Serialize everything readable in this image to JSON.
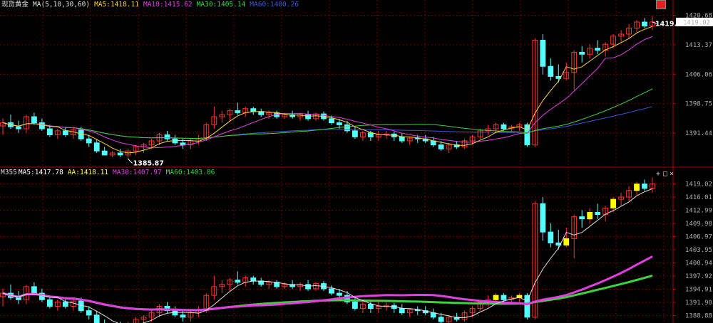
{
  "top": {
    "symbol": "现货黄金",
    "indicator": "MA(5,10,30,60)",
    "ma": [
      {
        "label": "MA5:1418.11",
        "color": "#ffd23f"
      },
      {
        "label": "MA10:1415.62",
        "color": "#e040e0"
      },
      {
        "label": "MA30:1405.14",
        "color": "#3fd23f"
      },
      {
        "label": "MA60:1400.26",
        "color": "#3a5ad8"
      }
    ],
    "last_price": "1419.02",
    "price_annotation": "1419.02",
    "low_annotation": "1385.87"
  },
  "bottom": {
    "indicator": "M355",
    "ma": [
      {
        "label": "MA5:1417.78",
        "color": "#ffffff"
      },
      {
        "label": "AA:1418.11",
        "color": "#ffff66"
      },
      {
        "label": "MA30:1407.97",
        "color": "#e040e0"
      },
      {
        "label": "MA60:1403.06",
        "color": "#3fd23f"
      }
    ],
    "controls": [
      "+",
      "□",
      "×"
    ]
  },
  "colors": {
    "up": "#ff3232",
    "down": "#54ffff",
    "grid": "#7a0000",
    "ma5": "#ffd23f",
    "ma10": "#e040e0",
    "ma30": "#3fd23f",
    "ma60": "#3a5ad8"
  },
  "chart_data": [
    {
      "type": "candlestick",
      "title": "现货黄金",
      "y_ticks": [
        "1420.68",
        "1413.37",
        "1406.06",
        "1398.75",
        "1391.44"
      ],
      "ylim": [
        1383.5,
        1422.0
      ],
      "candles": [
        [
          1393.2,
          1395.1,
          1391.0,
          1394.0
        ],
        [
          1394.0,
          1396.0,
          1392.5,
          1393.0
        ],
        [
          1393.0,
          1394.5,
          1391.5,
          1392.5
        ],
        [
          1392.5,
          1396.0,
          1391.5,
          1395.5
        ],
        [
          1395.5,
          1396.5,
          1393.5,
          1394.0
        ],
        [
          1394.0,
          1395.0,
          1392.0,
          1392.5
        ],
        [
          1392.5,
          1393.5,
          1390.5,
          1391.0
        ],
        [
          1391.0,
          1392.5,
          1390.0,
          1392.0
        ],
        [
          1392.0,
          1393.0,
          1390.5,
          1391.0
        ],
        [
          1391.0,
          1393.0,
          1390.0,
          1392.2
        ],
        [
          1392.2,
          1393.0,
          1389.5,
          1390.0
        ],
        [
          1390.0,
          1391.0,
          1388.0,
          1389.0
        ],
        [
          1389.0,
          1390.0,
          1386.5,
          1387.0
        ],
        [
          1387.0,
          1388.0,
          1385.87,
          1386.0
        ],
        [
          1386.0,
          1387.0,
          1385.5,
          1386.5
        ],
        [
          1386.5,
          1387.5,
          1385.5,
          1386.0
        ],
        [
          1386.0,
          1387.5,
          1385.0,
          1387.0
        ],
        [
          1387.0,
          1388.5,
          1386.0,
          1388.0
        ],
        [
          1388.0,
          1389.0,
          1386.5,
          1388.5
        ],
        [
          1388.5,
          1390.0,
          1387.5,
          1389.5
        ],
        [
          1389.5,
          1391.5,
          1388.5,
          1391.0
        ],
        [
          1391.0,
          1392.0,
          1389.5,
          1390.0
        ],
        [
          1390.0,
          1391.0,
          1388.5,
          1389.0
        ],
        [
          1389.0,
          1390.0,
          1387.5,
          1388.5
        ],
        [
          1388.5,
          1390.0,
          1387.5,
          1389.5
        ],
        [
          1389.5,
          1391.0,
          1388.5,
          1390.0
        ],
        [
          1390.0,
          1394.0,
          1389.5,
          1393.5
        ],
        [
          1393.5,
          1398.0,
          1392.5,
          1395.5
        ],
        [
          1395.5,
          1397.0,
          1394.0,
          1396.0
        ],
        [
          1396.0,
          1397.5,
          1394.5,
          1397.0
        ],
        [
          1397.0,
          1399.0,
          1396.0,
          1396.5
        ],
        [
          1396.5,
          1398.0,
          1395.5,
          1397.5
        ],
        [
          1397.5,
          1398.0,
          1396.0,
          1396.8
        ],
        [
          1396.8,
          1397.5,
          1395.5,
          1396.0
        ],
        [
          1396.0,
          1397.0,
          1395.0,
          1396.5
        ],
        [
          1396.5,
          1397.0,
          1395.0,
          1395.5
        ],
        [
          1395.5,
          1396.5,
          1395.0,
          1396.0
        ],
        [
          1396.0,
          1397.0,
          1395.0,
          1395.5
        ],
        [
          1395.5,
          1396.5,
          1394.5,
          1396.0
        ],
        [
          1396.0,
          1397.0,
          1394.5,
          1395.0
        ],
        [
          1395.0,
          1396.5,
          1394.5,
          1396.2
        ],
        [
          1396.2,
          1396.8,
          1394.5,
          1395.0
        ],
        [
          1395.0,
          1395.8,
          1393.5,
          1394.0
        ],
        [
          1394.0,
          1395.0,
          1392.5,
          1393.5
        ],
        [
          1393.5,
          1394.5,
          1391.5,
          1392.0
        ],
        [
          1392.0,
          1393.0,
          1390.0,
          1390.5
        ],
        [
          1390.5,
          1392.0,
          1389.5,
          1391.5
        ],
        [
          1391.5,
          1392.0,
          1389.5,
          1390.5
        ],
        [
          1390.5,
          1392.0,
          1389.5,
          1391.0
        ],
        [
          1391.0,
          1392.0,
          1390.0,
          1391.2
        ],
        [
          1391.2,
          1391.8,
          1389.5,
          1390.5
        ],
        [
          1390.5,
          1391.5,
          1389.0,
          1389.5
        ],
        [
          1389.5,
          1390.5,
          1388.5,
          1390.2
        ],
        [
          1390.2,
          1391.0,
          1389.0,
          1390.0
        ],
        [
          1390.0,
          1391.0,
          1389.0,
          1389.5
        ],
        [
          1389.5,
          1390.5,
          1388.0,
          1388.5
        ],
        [
          1388.5,
          1389.5,
          1387.0,
          1387.5
        ],
        [
          1387.5,
          1389.0,
          1386.5,
          1388.5
        ],
        [
          1388.5,
          1389.5,
          1387.5,
          1388.0
        ],
        [
          1388.0,
          1390.0,
          1387.5,
          1389.5
        ],
        [
          1389.5,
          1391.0,
          1388.5,
          1390.5
        ],
        [
          1390.5,
          1392.5,
          1390.0,
          1392.0
        ],
        [
          1392.0,
          1393.5,
          1391.0,
          1392.5
        ],
        [
          1392.5,
          1394.0,
          1391.5,
          1393.5
        ],
        [
          1393.5,
          1394.0,
          1392.0,
          1392.5
        ],
        [
          1392.5,
          1393.5,
          1391.5,
          1393.0
        ],
        [
          1393.0,
          1394.0,
          1392.0,
          1393.5
        ],
        [
          1393.5,
          1394.0,
          1388.0,
          1388.5
        ],
        [
          1388.5,
          1415.0,
          1388.0,
          1414.5
        ],
        [
          1414.5,
          1416.0,
          1406.0,
          1408.0
        ],
        [
          1408.0,
          1410.0,
          1404.5,
          1405.5
        ],
        [
          1405.5,
          1408.5,
          1404.0,
          1405.0
        ],
        [
          1405.0,
          1409.0,
          1404.5,
          1406.5
        ],
        [
          1406.5,
          1412.0,
          1402.0,
          1411.5
        ],
        [
          1411.5,
          1413.0,
          1409.0,
          1411.0
        ],
        [
          1411.0,
          1413.5,
          1410.0,
          1412.5
        ],
        [
          1412.5,
          1414.5,
          1411.0,
          1412.0
        ],
        [
          1412.0,
          1414.0,
          1410.5,
          1413.5
        ],
        [
          1413.5,
          1416.0,
          1412.5,
          1415.5
        ],
        [
          1415.5,
          1417.0,
          1414.0,
          1416.0
        ],
        [
          1416.0,
          1418.5,
          1415.0,
          1417.5
        ],
        [
          1417.5,
          1419.5,
          1416.5,
          1419.0
        ],
        [
          1419.0,
          1420.0,
          1417.5,
          1418.0
        ],
        [
          1418.0,
          1420.5,
          1417.0,
          1419.02
        ]
      ]
    },
    {
      "type": "candlestick",
      "title": "M355",
      "y_ticks": [
        "1419.02",
        "1416.01",
        "1412.99",
        "1409.98",
        "1406.97",
        "1403.95",
        "1400.94",
        "1397.92",
        "1394.91",
        "1391.90",
        "1388.88"
      ],
      "ylim": [
        1387.5,
        1420.4
      ]
    }
  ]
}
